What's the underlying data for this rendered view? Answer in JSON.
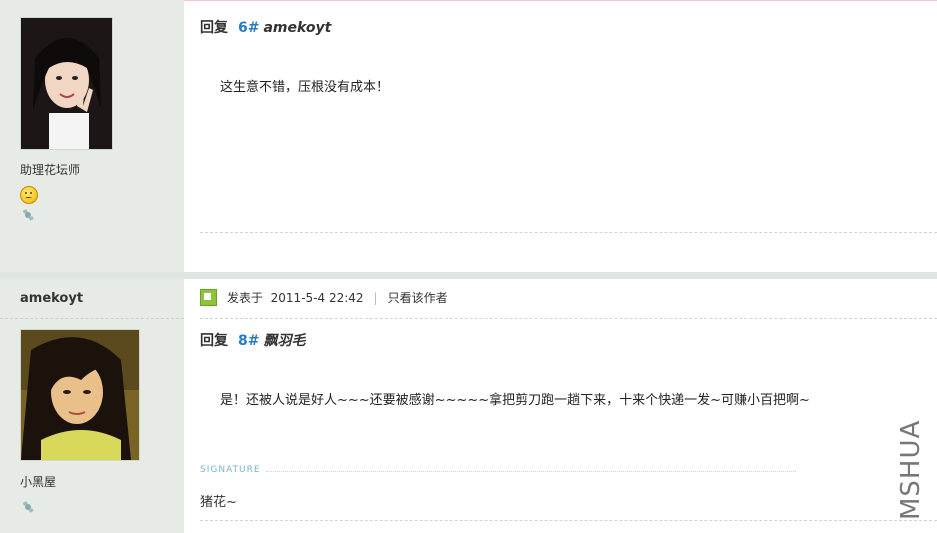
{
  "post1": {
    "rank": "助理花坛师",
    "reply_label": "回复",
    "reply_num": "6#",
    "reply_to": "amekoyt",
    "content": "这生意不错，压根没有成本！"
  },
  "post2": {
    "username": "amekoyt",
    "rank": "小黑屋",
    "posted_label": "发表于",
    "posted_time": "2011-5-4 22:42",
    "meta_sep": "|",
    "author_only": "只看该作者",
    "reply_label": "回复",
    "reply_num": "8#",
    "reply_to": "飘羽毛",
    "content": "是！还被人说是好人~~~还要被感谢~~~~~拿把剪刀跑一趟下来，十来个快递一发~可赚小百把啊~",
    "signature_label": "SIGNATURE",
    "signature": "猪花~"
  },
  "watermark": "MSHUA",
  "icons": {
    "smiley": "smiley-icon",
    "satellite": "satellite-icon",
    "post": "post-icon"
  },
  "colors": {
    "sidebar_bg": "#e6ebe6",
    "reply_number": "#2a7bc0",
    "signature_label": "#7fb3c8"
  }
}
